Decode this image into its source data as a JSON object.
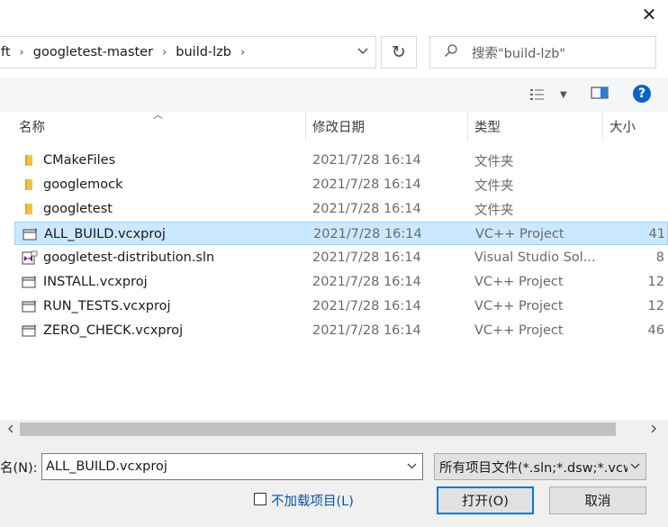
{
  "window": {
    "close_symbol": "✕"
  },
  "address": {
    "crumbs": [
      "ft",
      "googletest-master",
      "build-lzb"
    ],
    "dropdown_icon": "chevron-down-icon"
  },
  "refresh": {
    "symbol": "↻"
  },
  "search": {
    "placeholder": "搜索\"build-lzb\"",
    "icon": "search-icon"
  },
  "toolbar": {
    "view_icon": "details-view-icon",
    "pane_icon": "preview-pane-icon",
    "help": "?"
  },
  "columns": {
    "name": "名称",
    "date": "修改日期",
    "type": "类型",
    "size": "大小"
  },
  "files": [
    {
      "name": "CMakeFiles",
      "date": "2021/7/28 16:14",
      "type": "文件夹",
      "size": "",
      "icon": "folder-icon"
    },
    {
      "name": "googlemock",
      "date": "2021/7/28 16:14",
      "type": "文件夹",
      "size": "",
      "icon": "folder-icon"
    },
    {
      "name": "googletest",
      "date": "2021/7/28 16:14",
      "type": "文件夹",
      "size": "",
      "icon": "folder-icon"
    },
    {
      "name": "ALL_BUILD.vcxproj",
      "date": "2021/7/28 16:14",
      "type": "VC++ Project",
      "size": "41",
      "icon": "vcxproj-icon",
      "selected": true
    },
    {
      "name": "googletest-distribution.sln",
      "date": "2021/7/28 16:14",
      "type": "Visual Studio Sol...",
      "size": "8",
      "icon": "sln-icon"
    },
    {
      "name": "INSTALL.vcxproj",
      "date": "2021/7/28 16:14",
      "type": "VC++ Project",
      "size": "12",
      "icon": "vcxproj-icon"
    },
    {
      "name": "RUN_TESTS.vcxproj",
      "date": "2021/7/28 16:14",
      "type": "VC++ Project",
      "size": "12",
      "icon": "vcxproj-icon"
    },
    {
      "name": "ZERO_CHECK.vcxproj",
      "date": "2021/7/28 16:14",
      "type": "VC++ Project",
      "size": "46",
      "icon": "vcxproj-icon"
    }
  ],
  "bottom": {
    "filename_label": "名(N):",
    "filename_value": "ALL_BUILD.vcxproj",
    "filter_value": "所有项目文件(*.sln;*.dsw;*.vcw",
    "readonly_label": "不加载项目(L)",
    "open_button": "打开(O)",
    "cancel_button": "取消"
  },
  "colors": {
    "selection": "#cce8ff",
    "accent": "#0078d7",
    "folder": "#f3c04a"
  }
}
